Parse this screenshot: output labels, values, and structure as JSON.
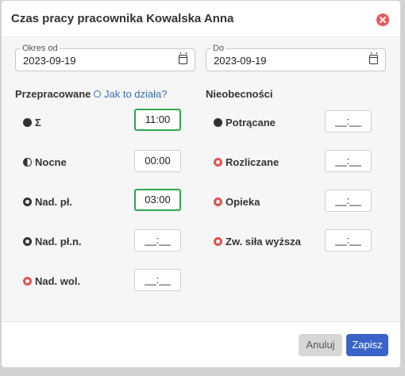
{
  "dialog": {
    "title": "Czas pracy pracownika Kowalska Anna",
    "close_icon": "close-circle-icon"
  },
  "dates": {
    "from": {
      "label": "Okres od",
      "value": "2023-09-19"
    },
    "to": {
      "label": "Do",
      "value": "2023-09-19"
    }
  },
  "worked": {
    "title": "Przepracowane",
    "help_label": "Jak to działa?",
    "rows": [
      {
        "icon": "gear-icon",
        "label": "Σ",
        "value": "11:00",
        "highlighted": true
      },
      {
        "icon": "half-circle-icon",
        "label": "Nocne",
        "value": "00:00",
        "highlighted": false
      },
      {
        "icon": "gear-icon",
        "label": "Nad. pł.",
        "value": "03:00",
        "highlighted": true
      },
      {
        "icon": "gear-icon",
        "label": "Nad. pł.n.",
        "value": "__:__",
        "highlighted": false
      },
      {
        "icon": "gear-icon",
        "label": "Nad. wol.",
        "value": "__:__",
        "highlighted": false
      }
    ]
  },
  "absences": {
    "title": "Nieobecności",
    "rows": [
      {
        "icon": "gear-icon",
        "label": "Potrącane",
        "value": "__:__"
      },
      {
        "icon": "gear-icon",
        "label": "Rozliczane",
        "value": "__:__"
      },
      {
        "icon": "gear-icon",
        "label": "Opieka",
        "value": "__:__"
      },
      {
        "icon": "gear-icon",
        "label": "Zw. siła wyższa",
        "value": "__:__"
      }
    ]
  },
  "footer": {
    "cancel_label": "Anuluj",
    "save_label": "Zapisz"
  },
  "colors": {
    "highlight": "#2fa84f",
    "primary": "#3a63c8",
    "danger": "#e85858",
    "link": "#3a6fb4"
  }
}
